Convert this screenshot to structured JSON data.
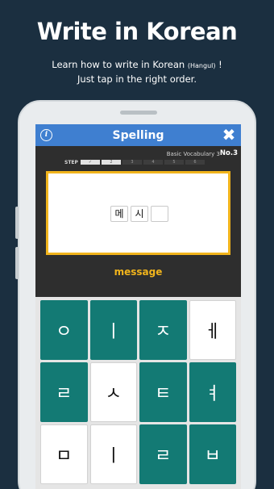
{
  "promo": {
    "title": "Write in Korean",
    "subtitle_line1": "Learn how to write in Korean",
    "subtitle_small": "(Hangul)",
    "subtitle_bang": "!",
    "subtitle_line2": "Just tap in the right order."
  },
  "app": {
    "title": "Spelling",
    "info_icon": "i",
    "close_icon": "✖"
  },
  "meta": {
    "deck": "Basic Vocabulary 3",
    "number": "No.3"
  },
  "steps": {
    "label": "STEP",
    "cells": [
      "✓",
      "2",
      "3",
      "4",
      "5",
      "6"
    ],
    "completed_count": 2
  },
  "answer": {
    "slots": [
      "메",
      "시",
      ""
    ]
  },
  "english": "message",
  "keyboard": {
    "keys": [
      {
        "label": "ㅇ",
        "style": "teal"
      },
      {
        "label": "ㅣ",
        "style": "teal"
      },
      {
        "label": "ㅈ",
        "style": "teal"
      },
      {
        "label": "ㅔ",
        "style": "white"
      },
      {
        "label": "ㄹ",
        "style": "teal"
      },
      {
        "label": "ㅅ",
        "style": "white"
      },
      {
        "label": "ㅌ",
        "style": "teal"
      },
      {
        "label": "ㅕ",
        "style": "teal"
      },
      {
        "label": "ㅁ",
        "style": "white"
      },
      {
        "label": "ㅣ",
        "style": "white"
      },
      {
        "label": "ㄹ",
        "style": "teal"
      },
      {
        "label": "ㅂ",
        "style": "teal"
      }
    ]
  },
  "colors": {
    "background": "#1b2f40",
    "appbar": "#3f7fd0",
    "accent": "#f1b41c",
    "key_teal": "#137a74"
  }
}
